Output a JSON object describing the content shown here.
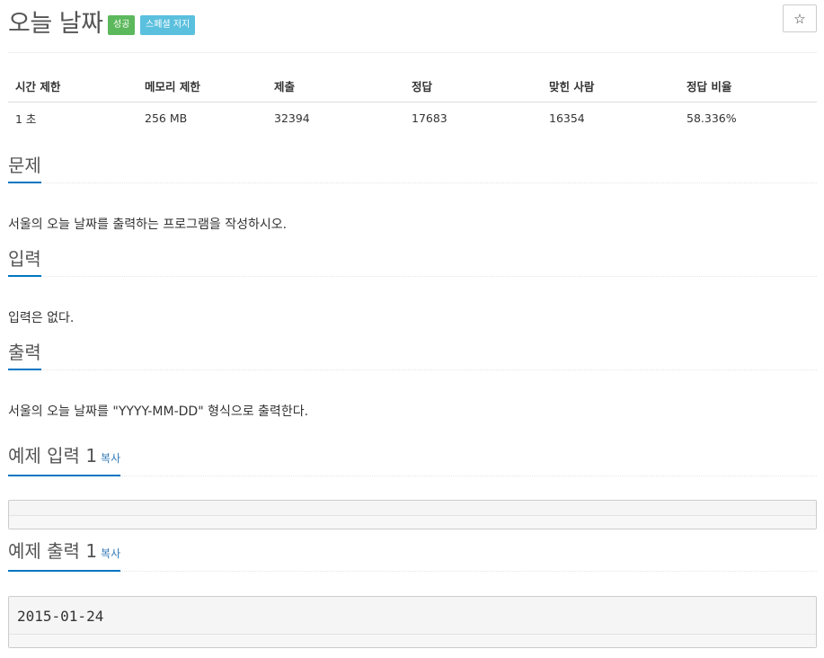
{
  "problem": {
    "title": "오늘 날짜",
    "badges": {
      "success": "성공",
      "special": "스페셜 저지"
    },
    "star_icon": "☆"
  },
  "info_table": {
    "headers": [
      "시간 제한",
      "메모리 제한",
      "제출",
      "정답",
      "맞힌 사람",
      "정답 비율"
    ],
    "row": [
      "1 초",
      "256 MB",
      "32394",
      "17683",
      "16354",
      "58.336%"
    ]
  },
  "sections": {
    "description": {
      "title": "문제",
      "text": "서울의 오늘 날짜를 출력하는 프로그램을 작성하시오."
    },
    "input": {
      "title": "입력",
      "text": "입력은 없다."
    },
    "output": {
      "title": "출력",
      "text": "서울의 오늘 날짜를 \"YYYY-MM-DD\" 형식으로 출력한다."
    }
  },
  "samples": {
    "input": {
      "title": "예제 입력 1",
      "copy_label": "복사",
      "value": ""
    },
    "output": {
      "title": "예제 출력 1",
      "copy_label": "복사",
      "value": "2015-01-24"
    }
  },
  "colors": {
    "success": "#5cb85c",
    "info": "#5bc0de",
    "accent": "#0076c0",
    "link": "#337ab7"
  }
}
